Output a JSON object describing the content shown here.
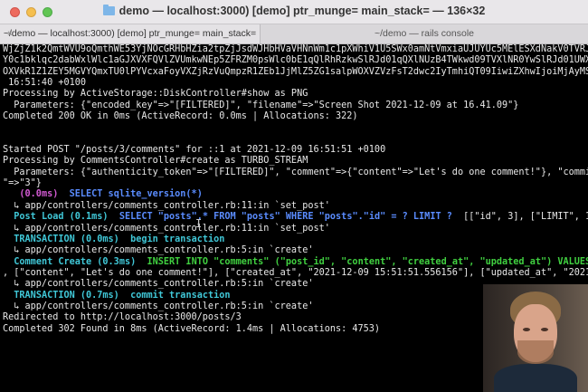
{
  "window": {
    "title": "demo — localhost:3000) [demo] ptr_munge= main_stack= — 136×32"
  },
  "tabs": [
    {
      "label": "~/demo — localhost:3000) [demo] ptr_munge= main_stack="
    },
    {
      "label": "~/demo — rails console"
    }
  ],
  "terminal": {
    "lines": [
      {
        "segments": [
          {
            "text": "WjZjZ1k2QmtWVU9oQmthWE53YjNOcGRHbHZia2tpZjJsdWJHbHVaVHNnWm1c1pXWhiV1U5SWx0amNtVmxiaUJUYUc5MElESXdNakV0TVRJdE1Ea2dZWFFnTVRZdU5ERXVNRGt1"
          }
        ]
      },
      {
        "segments": [
          {
            "text": "Y0c1bklqc2dabWxlWlc1aGJXVXFQVlZVUmkwNEp5ZFRZM0psWlc0bE1qQlRhRzkwSlRJd01qQXlNUzB4TWkwd09TVXlNR0YwSlRJd01UWXVOREV1TURrdWNHNW5CanNHVkRvVUky"
          }
        ]
      },
      {
        "segments": [
          {
            "text": "OXVkR1Z1ZEY5MGVYQmxTU0lPYVcxaFoyVXZjRzVuQmpzR1ZEb1JjMlZ5ZG1salpWOXVZVzFsT2dwc2IyTmhiQT09IiwiZXhwIjoiMjAyMS0xMi0wOVQxNTo1NjowMC40MDBaIiwicHVyIjoiYmxvYl9rZXkifX0=--eb409a855f7215429e186e324eb8960a76a57ff4/Screen%20Shot%202021-12-09%20at%2016.41.09.png\" for ::1 at 2021-12-09"
          }
        ]
      },
      {
        "segments": [
          {
            "text": " 16:51:40 +0100"
          }
        ]
      },
      {
        "segments": [
          {
            "text": "Processing by ActiveStorage::DiskController#show as PNG"
          }
        ]
      },
      {
        "segments": [
          {
            "text": "  Parameters: {\"encoded_key\"=>\"[FILTERED]\", \"filename\"=>\"Screen Shot 2021-12-09 at 16.41.09\"}"
          }
        ]
      },
      {
        "segments": [
          {
            "text": "Completed 200 OK in 0ms (ActiveRecord: 0.0ms | Allocations: 322)"
          }
        ]
      },
      {
        "segments": [
          {
            "text": ""
          }
        ]
      },
      {
        "segments": [
          {
            "text": ""
          }
        ]
      },
      {
        "segments": [
          {
            "text": "Started POST \"/posts/3/comments\" for ::1 at 2021-12-09 16:51:51 +0100"
          }
        ]
      },
      {
        "segments": [
          {
            "text": "Processing by CommentsController#create as TURBO_STREAM"
          }
        ]
      },
      {
        "segments": [
          {
            "text": "  Parameters: {\"authenticity_token\"=>\"[FILTERED]\", \"comment\"=>{\"content\"=>\"Let's do one comment!\"}, \"commit\"=>\"Create Comment\", \"post_id"
          }
        ]
      },
      {
        "segments": [
          {
            "text": "\"=>\"3\"}"
          }
        ]
      },
      {
        "segments": [
          {
            "text": "   ",
            "class": ""
          },
          {
            "text": "(0.0ms)",
            "class": "magenta"
          },
          {
            "text": "  "
          },
          {
            "text": "SELECT sqlite_version(*)",
            "class": "blue"
          }
        ]
      },
      {
        "segments": [
          {
            "text": "  ↳ app/controllers/comments_controller.rb:11:in `set_post'"
          }
        ]
      },
      {
        "segments": [
          {
            "text": "  "
          },
          {
            "text": "Post Load (0.1ms)",
            "class": "cyan"
          },
          {
            "text": "  "
          },
          {
            "text": "SELECT \"posts\".* FROM \"posts\" WHERE \"posts\".\"id\" = ? LIMIT ?",
            "class": "blue"
          },
          {
            "text": "  [[\"id\", 3], [\"LIMIT\", 1]]"
          }
        ]
      },
      {
        "segments": [
          {
            "text": "  ↳ app/controllers/comments_controller.rb:11:in `set_post'"
          }
        ]
      },
      {
        "segments": [
          {
            "text": "  "
          },
          {
            "text": "TRANSACTION (0.0ms)",
            "class": "cyan"
          },
          {
            "text": "  "
          },
          {
            "text": "begin transaction",
            "class": "cyan"
          }
        ]
      },
      {
        "segments": [
          {
            "text": "  ↳ app/controllers/comments_controller.rb:5:in `create'"
          }
        ]
      },
      {
        "segments": [
          {
            "text": "  "
          },
          {
            "text": "Comment Create (0.3ms)",
            "class": "cyan"
          },
          {
            "text": "  "
          },
          {
            "text": "INSERT INTO \"comments\" (\"post_id\", \"content\", \"created_at\", \"updated_at\") VALUES (?,",
            "class": "green"
          }
        ]
      },
      {
        "segments": [
          {
            "text": ", [\"content\", \"Let's do one comment!\"], [\"created_at\", \"2021-12-09 15:51:51.556156\"], [\"updated_at\", \"2021-12-09"
          }
        ]
      },
      {
        "segments": [
          {
            "text": "  ↳ app/controllers/comments_controller.rb:5:in `create'"
          }
        ]
      },
      {
        "segments": [
          {
            "text": "  "
          },
          {
            "text": "TRANSACTION (0.7ms)",
            "class": "cyan"
          },
          {
            "text": "  "
          },
          {
            "text": "commit transaction",
            "class": "cyan"
          }
        ]
      },
      {
        "segments": [
          {
            "text": "  ↳ app/controllers/comments_controller.rb:5:in `create'"
          }
        ]
      },
      {
        "segments": [
          {
            "text": "Redirected to http://localhost:3000/posts/3"
          }
        ]
      },
      {
        "segments": [
          {
            "text": "Completed 302 Found in 8ms (ActiveRecord: 1.4ms | Allocations: 4753)"
          }
        ]
      }
    ]
  },
  "colors": {
    "background": "#000000",
    "text": "#e8e8e8",
    "magenta": "#d25ad2",
    "cyan": "#40c8d8",
    "blue": "#5a8cff",
    "green": "#40d040"
  },
  "icons": {
    "window_close": "close-icon",
    "window_minimize": "minimize-icon",
    "window_zoom": "zoom-icon",
    "title_folder": "folder-icon",
    "tab_close": "close-icon",
    "text_cursor": "ibeam-cursor-icon"
  },
  "tab_close_glyph": "×",
  "cursor_glyph": "I"
}
